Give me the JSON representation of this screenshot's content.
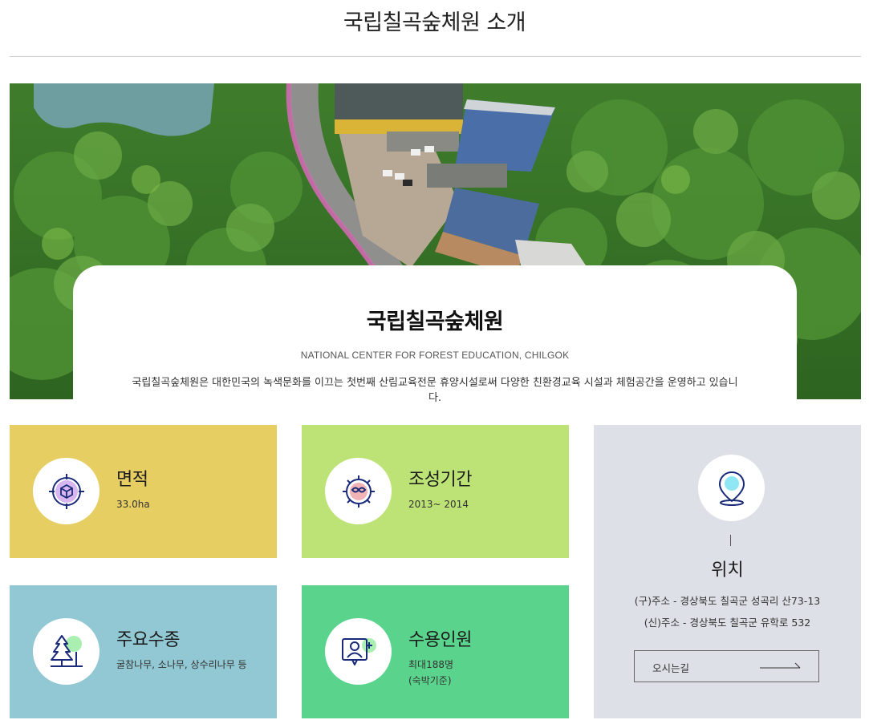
{
  "page_title": "국립칠곡숲체원 소개",
  "intro": {
    "name": "국립칠곡숲체원",
    "name_en": "NATIONAL CENTER FOR FOREST EDUCATION, CHILGOK",
    "description": "국립칠곡숲체원은 대한민국의 녹색문화를 이끄는 첫번째 산림교육전문 휴양시설로써 다양한 친환경교육 시설과 체험공간을 운영하고 있습니다."
  },
  "tiles": {
    "area": {
      "title": "면적",
      "value": "33.0ha",
      "icon": "target-cube-icon",
      "color": "#e6ce63"
    },
    "period": {
      "title": "조성기간",
      "value": "2013~ 2014",
      "icon": "gear-leaf-icon",
      "color": "#bde376"
    },
    "species": {
      "title": "주요수종",
      "value": "굴참나무, 소나무, 상수리나무 등",
      "icon": "tree-icon",
      "color": "#91c8d3"
    },
    "capacity": {
      "title": "수용인원",
      "value": "최대188명",
      "value2": "(숙박기준)",
      "icon": "person-add-icon",
      "color": "#5ad48c"
    }
  },
  "location": {
    "title": "위치",
    "address_old": "(구)주소 - 경상북도 칠곡군 성곡리 산73-13",
    "address_new": "(신)주소 - 경상북도 칠곡군 유학로 532",
    "directions_label": "오시는길",
    "icon": "map-pin-icon",
    "color": "#dde0e6"
  }
}
